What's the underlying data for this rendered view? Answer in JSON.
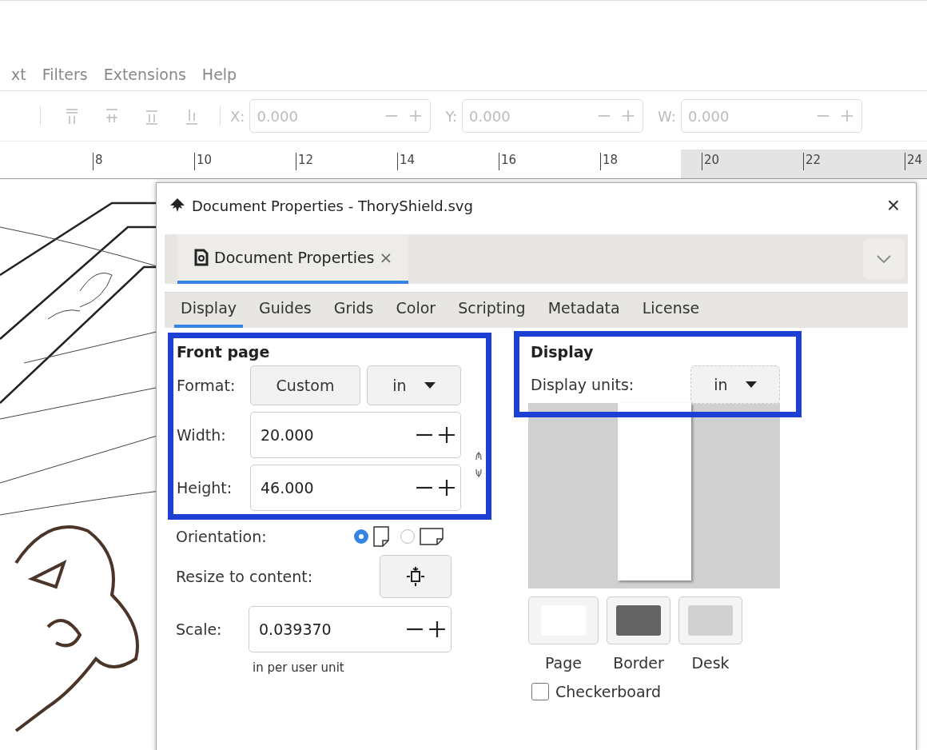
{
  "menu_bar": {
    "items": [
      "xt",
      "Filters",
      "Extensions",
      "Help"
    ]
  },
  "toolbar": {
    "disabled": true,
    "fields": [
      {
        "label": "X:",
        "value": "0.000"
      },
      {
        "label": "Y:",
        "value": "0.000"
      },
      {
        "label": "W:",
        "value": "0.000"
      }
    ]
  },
  "ruler": {
    "labels": [
      "8",
      "10",
      "12",
      "14",
      "16",
      "18",
      "20",
      "22",
      "24"
    ]
  },
  "dialog": {
    "title": "Document Properties - ThoryShield.svg",
    "close": "×",
    "panel_tab": {
      "label": "Document Properties",
      "close": "×",
      "selected": true
    },
    "tabs": [
      {
        "label": "Display",
        "selected": true
      },
      {
        "label": "Guides",
        "selected": false
      },
      {
        "label": "Grids",
        "selected": false
      },
      {
        "label": "Color",
        "selected": false
      },
      {
        "label": "Scripting",
        "selected": false
      },
      {
        "label": "Metadata",
        "selected": false
      },
      {
        "label": "License",
        "selected": false
      }
    ],
    "front_page": {
      "heading": "Front page",
      "format_label": "Format:",
      "format_value": "Custom",
      "format_unit": "in",
      "width_label": "Width:",
      "width_value": "20.000",
      "height_label": "Height:",
      "height_value": "46.000",
      "orientation_label": "Orientation:",
      "orientations": [
        {
          "kind": "portrait",
          "selected": true
        },
        {
          "kind": "landscape",
          "selected": false
        }
      ],
      "resize_label": "Resize to content:",
      "scale_label": "Scale:",
      "scale_value": "0.039370",
      "scale_hint": "in per user unit"
    },
    "display": {
      "heading": "Display",
      "units_label": "Display units:",
      "units_value": "in"
    },
    "colors": [
      {
        "label": "Page",
        "color": "#ffffff"
      },
      {
        "label": "Border",
        "color": "#636363"
      },
      {
        "label": "Desk",
        "color": "#d1d1d1"
      }
    ],
    "checkerboard": {
      "label": "Checkerboard",
      "checked": false
    }
  }
}
